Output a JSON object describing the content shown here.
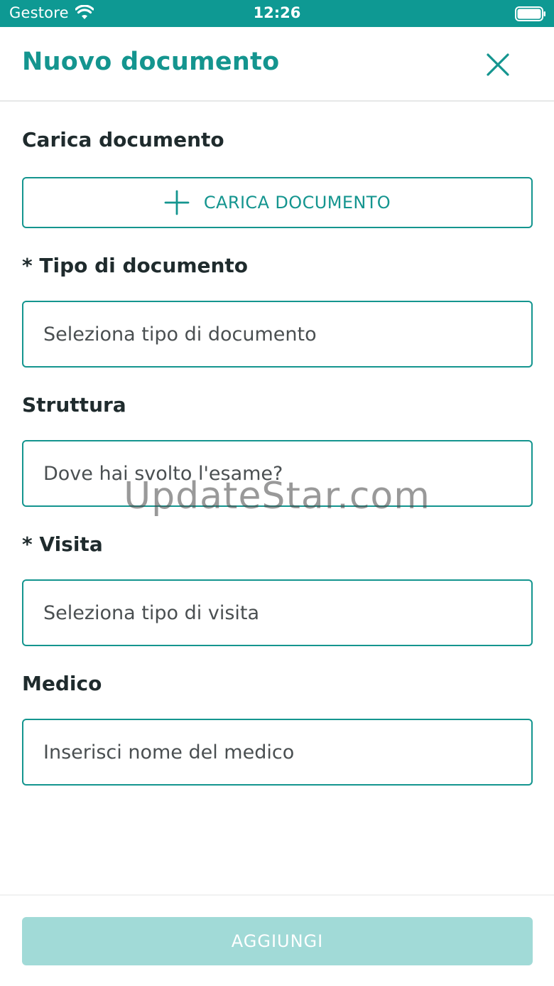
{
  "status_bar": {
    "carrier": "Gestore",
    "time": "12:26",
    "icons": [
      "wifi-icon",
      "battery-icon"
    ]
  },
  "header": {
    "title": "Nuovo documento",
    "close_icon": "close-icon"
  },
  "form": {
    "upload_section_label": "Carica documento",
    "upload_button_label": "CARICA DOCUMENTO",
    "document_type": {
      "label": "* Tipo di documento",
      "placeholder": "Seleziona tipo di documento",
      "value": ""
    },
    "structure": {
      "label": "Struttura",
      "placeholder": "Dove hai svolto l'esame?",
      "value": ""
    },
    "visit": {
      "label": "* Visita",
      "placeholder": "Seleziona tipo di visita",
      "value": ""
    },
    "doctor": {
      "label": "Medico",
      "placeholder": "Inserisci nome del medico",
      "value": ""
    }
  },
  "watermark": "UpdateStar.com",
  "footer": {
    "add_button_label": "AGGIUNGI"
  },
  "colors": {
    "accent": "#14958f",
    "status_bar": "#0e9993",
    "button_disabled": "#a1dad7"
  }
}
